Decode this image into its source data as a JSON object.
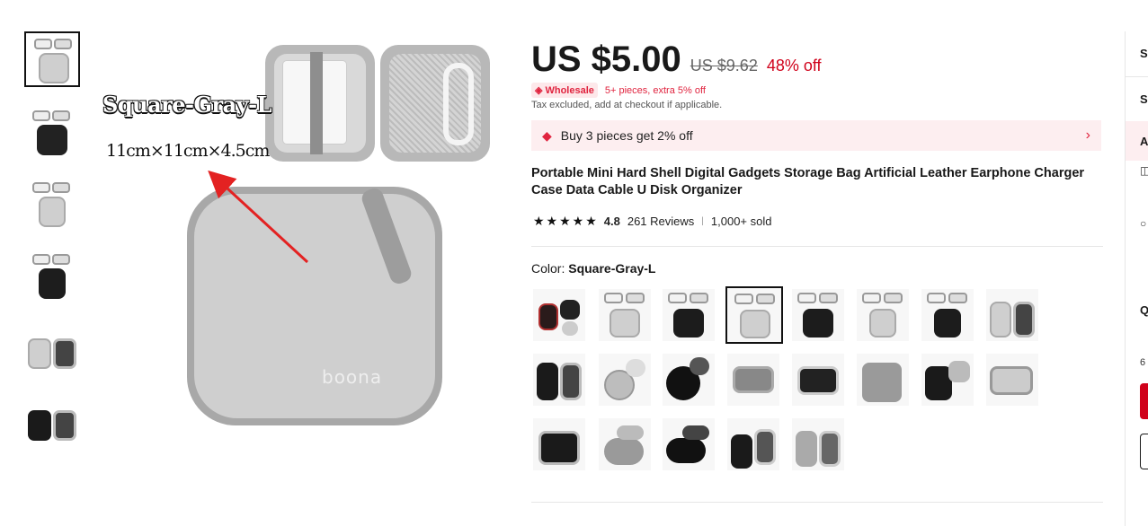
{
  "gallery": {
    "overlay_title": "Square-Gray-L",
    "overlay_dims": "11cm×11cm×4.5cm",
    "logo_text": "boona",
    "thumbnails": [
      {
        "label": "thumbnail-1",
        "selected": true
      },
      {
        "label": "thumbnail-2",
        "selected": false
      },
      {
        "label": "thumbnail-3",
        "selected": false
      },
      {
        "label": "thumbnail-4",
        "selected": false
      },
      {
        "label": "thumbnail-5",
        "selected": false
      },
      {
        "label": "thumbnail-6",
        "selected": false
      }
    ]
  },
  "price": {
    "current": "US $5.00",
    "original": "US $9.62",
    "discount": "48% off"
  },
  "wholesale": {
    "badge": "Wholesale",
    "note": "5+ pieces, extra 5% off"
  },
  "tax_note": "Tax excluded, add at checkout if applicable.",
  "promo": {
    "text": "Buy 3 pieces get 2% off"
  },
  "product_title": "Portable Mini Hard Shell Digital Gadgets Storage Bag Artificial Leather Earphone Charger Case Data Cable U Disk Organizer",
  "rating": {
    "stars": "★★★★★",
    "value": "4.8",
    "reviews": "261 Reviews",
    "sold": "1,000+ sold"
  },
  "color": {
    "label": "Color: ",
    "selected": "Square-Gray-L",
    "swatch_count": 21,
    "selected_index": 3
  },
  "right_panel": {
    "items": [
      "S",
      "S",
      "A",
      "Q",
      "6"
    ]
  },
  "colors": {
    "accent_red": "#d0021b",
    "wholesale_pink": "#e0243f",
    "promo_bg": "#fdeef0"
  }
}
